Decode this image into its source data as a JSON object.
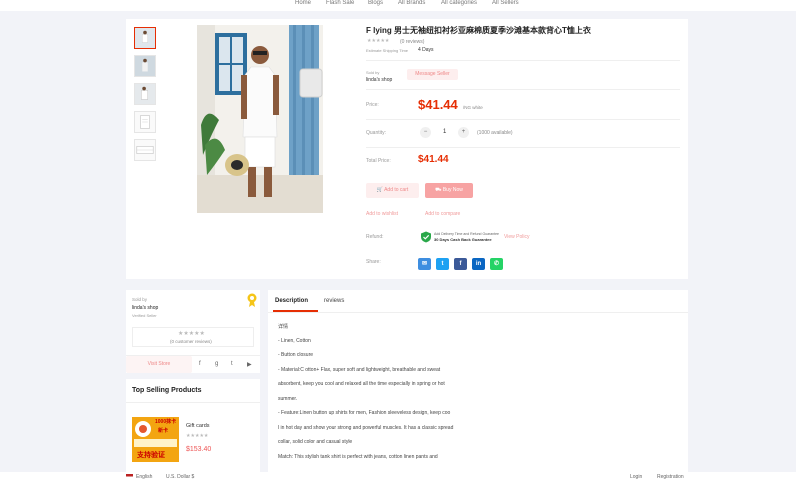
{
  "nav": [
    "Home",
    "Flash Sale",
    "Blogs",
    "All Brands",
    "All categories",
    "All Sellers"
  ],
  "product": {
    "title": "F lying 男士无袖纽扣衬衫亚麻棉质夏季沙滩基本款背心T恤上衣",
    "reviews": "(0 reviews)",
    "shipping_label": "Estimate Shipping Time",
    "shipping_value": "4 Days",
    "sold_by_label": "Sold by",
    "seller": "linda's shop",
    "message_btn": "Message Seller",
    "price_label": "Price:",
    "price": "$41.44",
    "price_unit": "/NG white",
    "quantity_label": "Quantity:",
    "quantity_minus": "−",
    "quantity_value": "1",
    "quantity_plus": "+",
    "available": "(1000 available)",
    "total_label": "Total Price:",
    "total_price": "$41.44",
    "add_to_cart": "Add to cart",
    "buy_now": "Buy Now",
    "wishlist": "Add to wishlist",
    "compare": "Add to compare",
    "refund_label": "Refund:",
    "refund_line1": "Add Delivery Time and Refund Guarantee",
    "refund_line2": "30 Days Cash Back Guarantee",
    "view_policy": "View Policy",
    "share_label": "Share:",
    "rating_stars": "★★★★★"
  },
  "seller_card": {
    "sold_by": "Sold by",
    "shop": "linda's shop",
    "verified": "Verified Seller",
    "stars": "★★★★★",
    "reviews": "(0 customer reviews)",
    "visit": "Visit Store"
  },
  "top_selling": {
    "title": "Top Selling Products",
    "item_name": "Gift cards",
    "item_stars": "★★★★★",
    "item_price": "$153.40",
    "thumb_text_1": "1000抹卡",
    "thumb_text_2": "新卡",
    "thumb_text_3": "支持验证"
  },
  "tabs": [
    "Description",
    "reviews"
  ],
  "description": [
    "详情",
    "- Linen, Cotton",
    "- Button closure",
    "- Material:C otton+ Flax, super soft and lightweight, breathable and sweat",
    "absorbent, keep you cool and relaxed all the time especially in spring or hot",
    "summer.",
    "- Feature:Linen button up shirts for men, Fashion sleeveless design, keep coo",
    "l in hot day and show your strong and powerful muscles. It has a classic spread",
    "collar, solid color and casual style",
    "Match: This stylish tank shirt is perfect with jeans, cotton linen pants and"
  ],
  "footer": {
    "language": "English",
    "currency": "U.S. Dollar $",
    "login": "Login",
    "registration": "Registration"
  },
  "colors": {
    "accent": "#e62e04",
    "email": "#3e8ee0",
    "twitter": "#1da1f2",
    "facebook": "#3b5998",
    "linkedin": "#0a66c2",
    "whatsapp": "#25d366"
  }
}
